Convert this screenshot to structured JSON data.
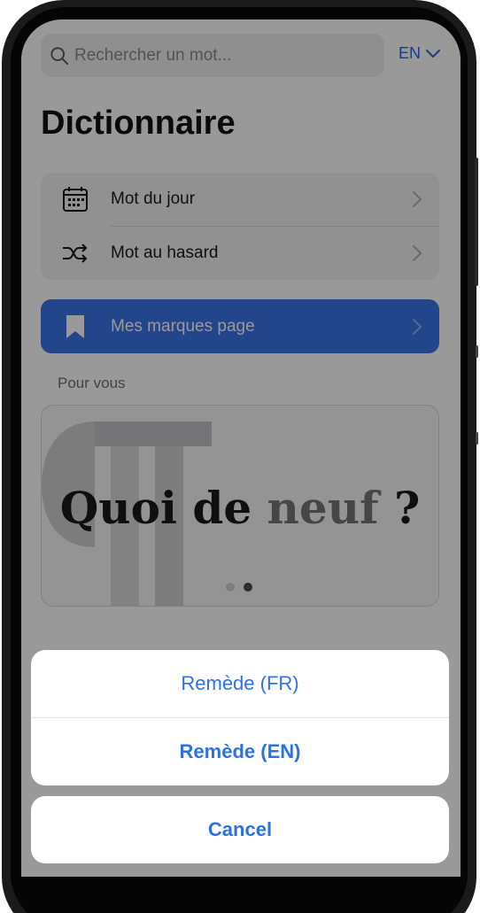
{
  "search": {
    "placeholder": "Rechercher un mot...",
    "icon": "search-icon"
  },
  "language": {
    "selected": "EN",
    "icon": "chevron-down-icon"
  },
  "page_title": "Dictionnaire",
  "menu": {
    "items": [
      {
        "label": "Mot du jour",
        "icon": "calendar-icon"
      },
      {
        "label": "Mot au hasard",
        "icon": "shuffle-icon"
      }
    ]
  },
  "bookmarks": {
    "label": "Mes marques page",
    "icon": "bookmark-icon"
  },
  "section_label": "Pour vous",
  "promo": {
    "title_part1": "Quoi de ",
    "title_accent": "neuf",
    "title_part2": " ?",
    "pager_count": 2,
    "pager_active": 2
  },
  "action_sheet": {
    "options": [
      {
        "label": "Remède (FR)"
      },
      {
        "label": "Remède (EN)"
      }
    ],
    "cancel_label": "Cancel"
  },
  "colors": {
    "accent": "#3a74e8",
    "sheet_text": "#2d72e4",
    "overlay": "rgba(0,0,0,0.40)"
  }
}
